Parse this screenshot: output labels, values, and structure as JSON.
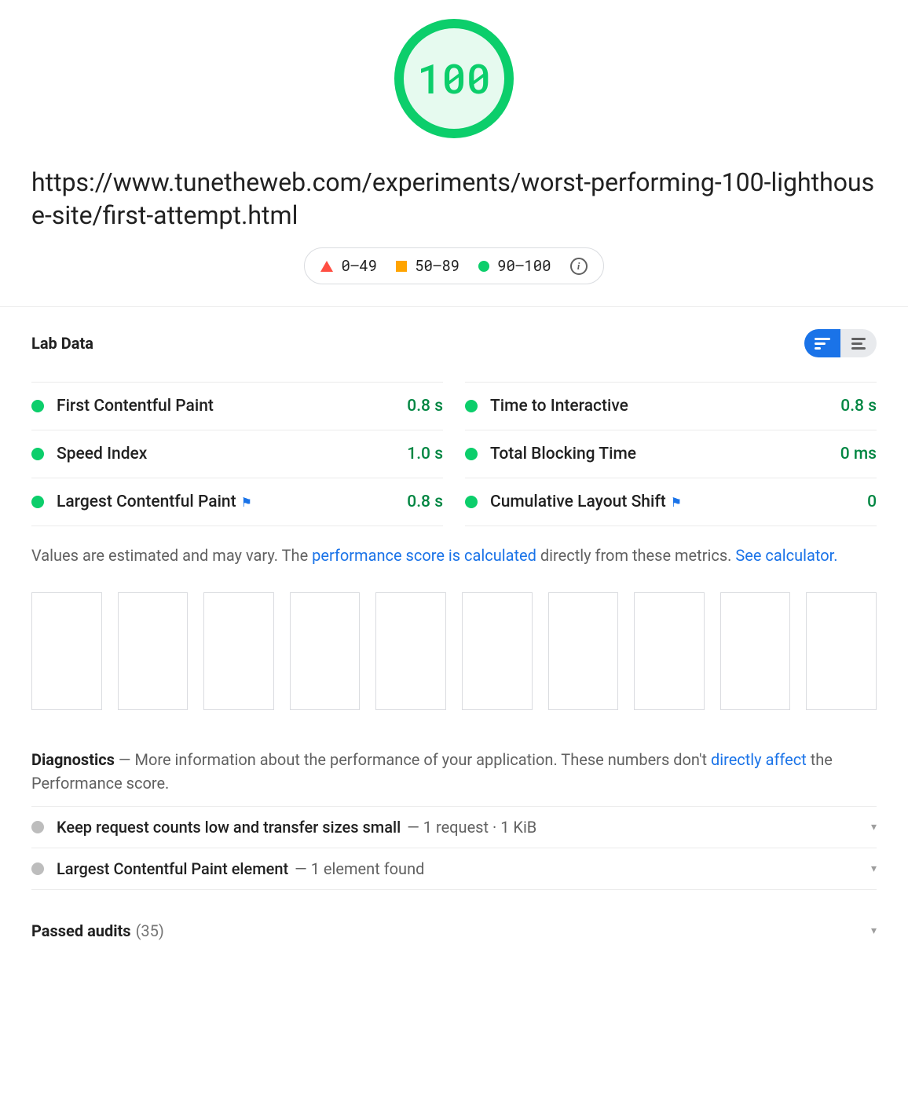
{
  "score": "100",
  "url": "https://www.tunetheweb.com/experiments/worst-performing-100-lighthouse-site/first-attempt.html",
  "legend": {
    "fail": "0–49",
    "avg": "50–89",
    "pass": "90–100"
  },
  "labdata_title": "Lab Data",
  "metrics": [
    {
      "name": "First Contentful Paint",
      "value": "0.8 s",
      "flag": false
    },
    {
      "name": "Time to Interactive",
      "value": "0.8 s",
      "flag": false
    },
    {
      "name": "Speed Index",
      "value": "1.0 s",
      "flag": false
    },
    {
      "name": "Total Blocking Time",
      "value": "0 ms",
      "flag": false
    },
    {
      "name": "Largest Contentful Paint",
      "value": "0.8 s",
      "flag": true
    },
    {
      "name": "Cumulative Layout Shift",
      "value": "0",
      "flag": true
    }
  ],
  "disclaimer": {
    "prefix": "Values are estimated and may vary. The ",
    "link1": "performance score is calculated",
    "mid": " directly from these metrics. ",
    "link2": "See calculator."
  },
  "diagnostics": {
    "title": "Diagnostics",
    "subtitle_prefix": " — More information about the performance of your application. These numbers don't ",
    "subtitle_link": "directly affect",
    "subtitle_suffix": " the Performance score.",
    "items": [
      {
        "label": "Keep request counts low and transfer sizes small",
        "detail": " — 1 request · 1 KiB"
      },
      {
        "label": "Largest Contentful Paint element",
        "detail": " — 1 element found"
      }
    ]
  },
  "passed": {
    "label": "Passed audits",
    "count": "(35)"
  }
}
